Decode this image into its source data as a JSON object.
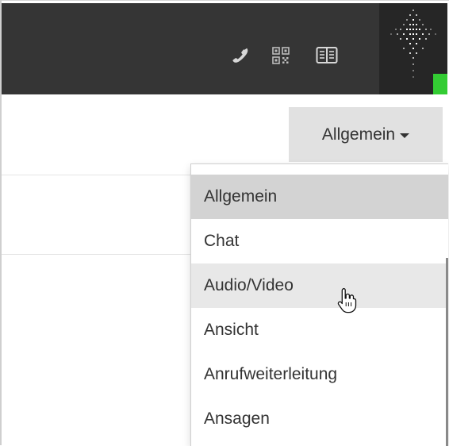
{
  "header": {
    "icons": [
      "phone-icon",
      "qr-code-icon",
      "book-icon",
      "brand-logo"
    ],
    "colors": {
      "background": "#353535",
      "accent": "#33cc33"
    }
  },
  "settings": {
    "dropdown": {
      "selected_label": "Allgemein",
      "items": [
        {
          "label": "Allgemein",
          "state": "selected"
        },
        {
          "label": "Chat",
          "state": "normal"
        },
        {
          "label": "Audio/Video",
          "state": "hover"
        },
        {
          "label": "Ansicht",
          "state": "normal"
        },
        {
          "label": "Anrufweiterleitung",
          "state": "normal"
        },
        {
          "label": "Ansagen",
          "state": "normal"
        }
      ]
    }
  },
  "cursor": {
    "type": "pointer-hand-icon"
  }
}
